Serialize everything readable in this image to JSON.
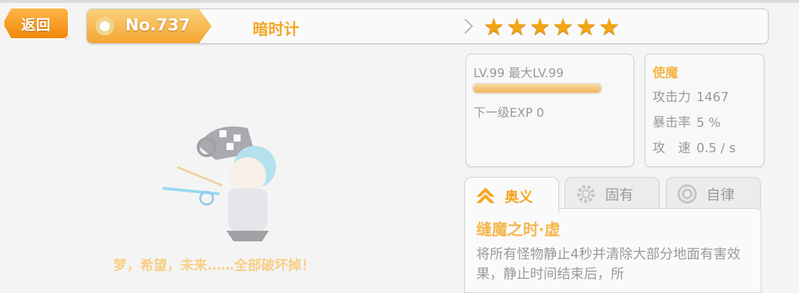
{
  "back_button": {
    "label": "返回"
  },
  "header": {
    "number": "No.737",
    "name": "暗时计",
    "star_count": 6,
    "star_icon": "star-icon",
    "accent_color": "#f5a623"
  },
  "level_panel": {
    "level_text": "LV.99 最大LV.99",
    "level_progress": 1.0,
    "next_exp_text": "下一级EXP 0"
  },
  "stats_panel": {
    "type": "使魔",
    "stats": [
      {
        "label": "攻击力",
        "value": "1467"
      },
      {
        "label": "暴击率",
        "value": "5 %"
      },
      {
        "label": "攻　速",
        "value": "0.5 / s"
      }
    ]
  },
  "tabs": [
    {
      "label": "奥义",
      "icon": "chevron-up-icon",
      "active": true
    },
    {
      "label": "固有",
      "icon": "gear-icon",
      "active": false
    },
    {
      "label": "自律",
      "icon": "target-icon",
      "active": false
    }
  ],
  "skill": {
    "name": "缝魔之时·虚",
    "description": "将所有怪物静止4秒并清除大部分地面有害效果，静止时间结束后，所"
  },
  "character": {
    "quote": "梦，希望，未来……全部破坏掉！"
  }
}
